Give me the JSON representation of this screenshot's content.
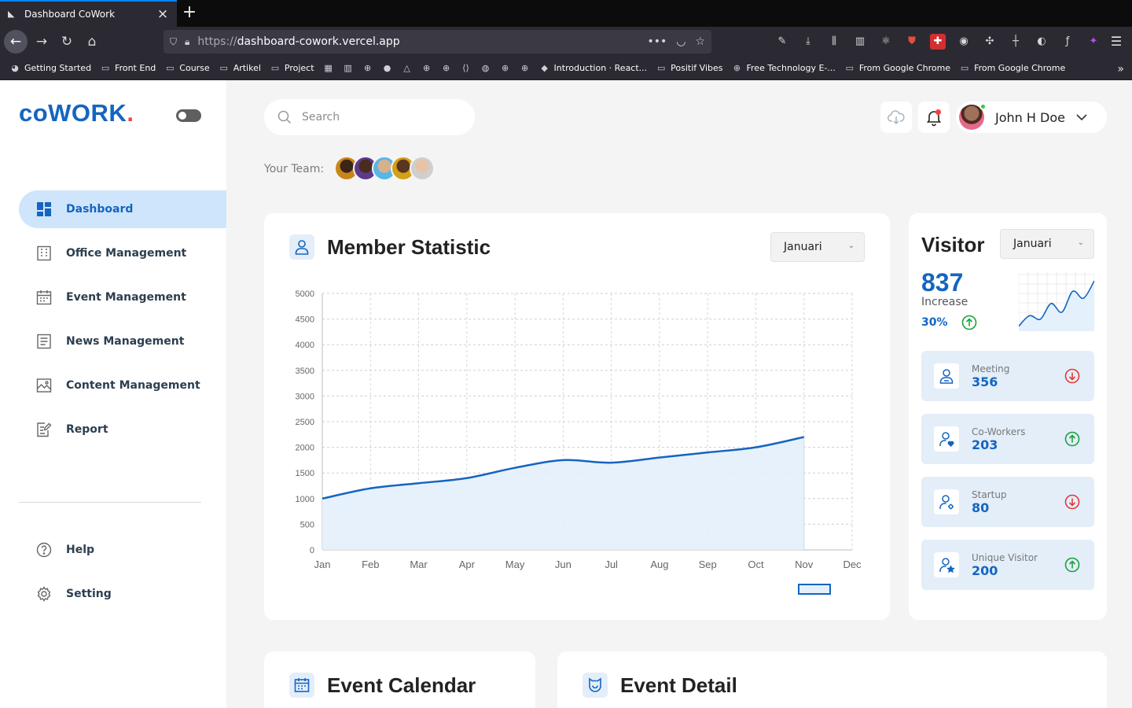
{
  "browser": {
    "tab_title": "Dashboard CoWork",
    "url_protocol": "https://",
    "url_host": "dashboard-cowork.vercel.app",
    "bookmarks": [
      {
        "label": "Getting Started",
        "icon": "firefox-icon"
      },
      {
        "label": "Front End",
        "icon": "folder-icon"
      },
      {
        "label": "Course",
        "icon": "folder-icon"
      },
      {
        "label": "Artikel",
        "icon": "folder-icon"
      },
      {
        "label": "Project",
        "icon": "folder-icon"
      },
      {
        "label": "",
        "icon": "calendar-icon"
      },
      {
        "label": "",
        "icon": "trello-icon"
      },
      {
        "label": "",
        "icon": "globe-icon"
      },
      {
        "label": "",
        "icon": "medium-icon"
      },
      {
        "label": "",
        "icon": "drive-icon"
      },
      {
        "label": "",
        "icon": "globe-icon"
      },
      {
        "label": "",
        "icon": "globe-icon"
      },
      {
        "label": "",
        "icon": "code-icon"
      },
      {
        "label": "",
        "icon": "github-icon"
      },
      {
        "label": "",
        "icon": "globe-icon"
      },
      {
        "label": "",
        "icon": "globe-icon"
      },
      {
        "label": "Introduction · React...",
        "icon": "book-icon"
      },
      {
        "label": "Positif Vibes",
        "icon": "folder-icon"
      },
      {
        "label": "Free Technology E-...",
        "icon": "globe-icon"
      },
      {
        "label": "From Google Chrome",
        "icon": "folder-icon"
      },
      {
        "label": "From Google Chrome",
        "icon": "folder-icon"
      }
    ]
  },
  "sidebar": {
    "logo": "coWORK",
    "logo_dot": ".",
    "items": [
      {
        "label": "Dashboard",
        "icon": "dashboard-icon",
        "active": true
      },
      {
        "label": "Office Management",
        "icon": "building-icon"
      },
      {
        "label": "Event Management",
        "icon": "calendar-icon"
      },
      {
        "label": "News Management",
        "icon": "news-icon"
      },
      {
        "label": "Content Management",
        "icon": "image-icon"
      },
      {
        "label": "Report",
        "icon": "report-icon"
      }
    ],
    "bottom_items": [
      {
        "label": "Help",
        "icon": "help-icon"
      },
      {
        "label": "Setting",
        "icon": "gear-icon"
      }
    ]
  },
  "header": {
    "search_placeholder": "Search",
    "user_name": "John H Doe",
    "team_label": "Your Team:"
  },
  "member_statistic": {
    "title": "Member Statistic",
    "month_select": "Januari"
  },
  "chart_data": {
    "type": "area",
    "title": "Member Statistic",
    "xlabel": "",
    "ylabel": "",
    "categories": [
      "Jan",
      "Feb",
      "Mar",
      "Apr",
      "May",
      "Jun",
      "Jul",
      "Aug",
      "Sep",
      "Oct",
      "Nov",
      "Dec"
    ],
    "series": [
      {
        "values": [
          1000,
          1200,
          1300,
          1400,
          1600,
          1750,
          1700,
          1800,
          1900,
          2000,
          2200,
          null
        ]
      }
    ],
    "ylim": [
      0,
      5000
    ],
    "yticks": [
      0,
      500,
      1000,
      1500,
      2000,
      2500,
      3000,
      3500,
      4000,
      4500,
      5000
    ],
    "grid": true,
    "legend": "bottom-right",
    "color": "#1565c0",
    "fill": "#e4f0fb"
  },
  "visitor": {
    "title": "Visitor",
    "month_select": "Januari",
    "count": "837",
    "increase_label": "Increase",
    "increase_pct": "30%",
    "sparkline": [
      2,
      8,
      6,
      15,
      10,
      22,
      18,
      28
    ],
    "stats": [
      {
        "label": "Meeting",
        "value": "356",
        "trend": "down"
      },
      {
        "label": "Co-Workers",
        "value": "203",
        "trend": "up"
      },
      {
        "label": "Startup",
        "value": "80",
        "trend": "down"
      },
      {
        "label": "Unique Visitor",
        "value": "200",
        "trend": "up"
      }
    ]
  },
  "event_calendar": {
    "title": "Event Calendar"
  },
  "event_detail": {
    "title": "Event Detail"
  },
  "colors": {
    "primary": "#1565c0",
    "accent_red": "#f4433f",
    "up_green": "#1aa33a",
    "down_red": "#e53935"
  }
}
